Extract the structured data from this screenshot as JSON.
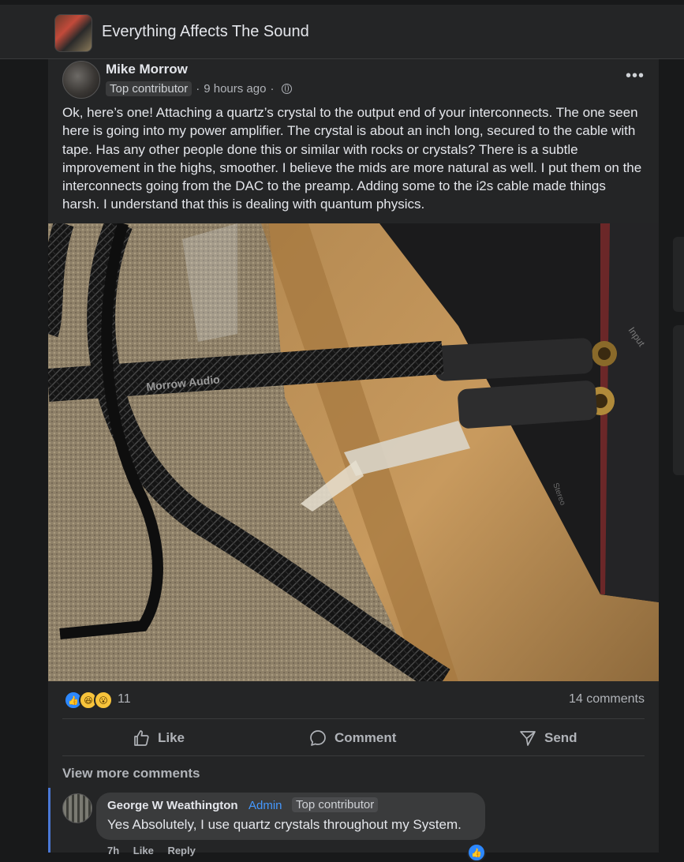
{
  "group": {
    "name": "Everything Affects The Sound"
  },
  "post": {
    "author": "Mike Morrow",
    "badge": "Top contributor",
    "time": "9 hours ago",
    "separator": "·",
    "privacy_icon": "globe-icon",
    "more_label": "•••",
    "text": "Ok, here’s one! Attaching a quartz’s crystal to the output end of your interconnects. The one seen here is going into my power amplifier. The crystal is about an inch long, secured to the cable with tape. Has any other people done this or similar with rocks or crystals? There is a subtle improvement in the highs, smoother. I believe the mids are more natural as well. I put them on the interconnects going from the DAC to the preamp. Adding some to the i2s cable made things harsh. I understand that this is dealing with quantum physics.",
    "photo": {
      "cable_brand": "Morrow Audio",
      "panel_label_input": "Input",
      "panel_label_stereo": "Stereo"
    }
  },
  "engagement": {
    "reaction_icons": [
      "like-icon",
      "haha-icon",
      "wow-icon"
    ],
    "reaction_count": "11",
    "comment_count": "14 comments"
  },
  "actions": {
    "like": "Like",
    "comment": "Comment",
    "send": "Send"
  },
  "comments": {
    "view_more": "View more comments",
    "items": [
      {
        "author": "George W Weathington",
        "admin_badge": "Admin",
        "contributor_badge": "Top contributor",
        "text": "Yes Absolutely, I use quartz crystals throughout my System.",
        "time": "7h",
        "like_label": "Like",
        "reply_label": "Reply"
      }
    ]
  },
  "colors": {
    "background": "#18191a",
    "surface": "#242526",
    "bubble": "#3a3b3c",
    "accent_blue": "#2d88ff",
    "admin_blue": "#4599ff"
  }
}
